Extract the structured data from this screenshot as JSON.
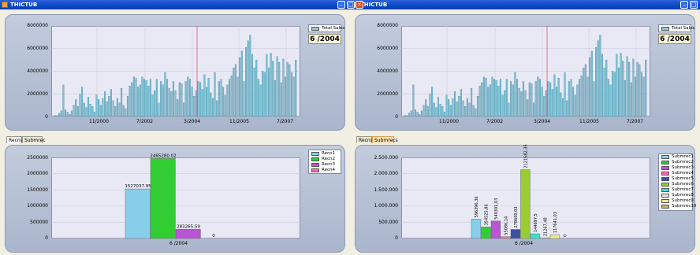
{
  "windows": [
    {
      "id": "left",
      "title": "THICTUB",
      "top_chart": {
        "chart_data": {
          "type": "bar",
          "series": [
            {
              "name": "Total Sales"
            }
          ],
          "x_tick_labels": [
            "11/2000",
            "7/2002",
            "3/2004",
            "11/2005",
            "7/2007"
          ],
          "y_tick_labels": [
            "8000000",
            "6000000",
            "4000000",
            "2000000",
            "0"
          ],
          "ylim": [
            0,
            8000000
          ],
          "cursor_label": "6 /2004",
          "values_millions": [
            0.1,
            0.1,
            0.3,
            0.5,
            2.8,
            0.6,
            0.4,
            0.2,
            0.5,
            1.0,
            1.5,
            0.9,
            2.0,
            2.6,
            1.2,
            0.8,
            1.7,
            1.1,
            0.9,
            0.4,
            1.9,
            1.5,
            1.0,
            1.6,
            2.2,
            1.3,
            1.8,
            2.4,
            1.4,
            0.9,
            1.6,
            1.2,
            2.5,
            1.0,
            0.7,
            1.8,
            2.7,
            3.0,
            3.5,
            3.4,
            2.6,
            2.8,
            3.5,
            3.3,
            3.2,
            2.7,
            3.3,
            1.9,
            2.3,
            3.3,
            1.2,
            3.1,
            2.8,
            3.9,
            3.3,
            2.5,
            2.2,
            3.1,
            2.3,
            1.5,
            3.0,
            2.9,
            1.2,
            3.1,
            3.5,
            3.3,
            2.6,
            1.8,
            2.3,
            3.1,
            3.0,
            2.4,
            3.7,
            2.6,
            3.4,
            2.1,
            1.6,
            3.9,
            1.4,
            3.1,
            3.3,
            2.6,
            1.9,
            2.8,
            3.3,
            3.6,
            4.3,
            4.6,
            3.5,
            5.2,
            5.8,
            3.1,
            6.1,
            6.7,
            7.2,
            5.5,
            4.3,
            5.0,
            3.3,
            2.8,
            4.0,
            3.9,
            5.5,
            4.3,
            5.6,
            4.9,
            3.2,
            5.3,
            4.8,
            3.0,
            5.1,
            3.5,
            4.8,
            4.6,
            3.9,
            3.5,
            5.0
          ]
        }
      },
      "tabs": [
        "Recns",
        "Submrec"
      ],
      "active_tab": 0,
      "bottom_chart": {
        "chart_data": {
          "type": "bar",
          "categories": [
            "6 /2004"
          ],
          "y_tick_labels": [
            "2500000",
            "2000000",
            "1500000",
            "1000000",
            "500000",
            "0"
          ],
          "ylim": [
            0,
            2500000
          ],
          "series": [
            {
              "name": "Recn1",
              "value": 1527037.95,
              "label": "1527037.95",
              "color": "#87ceeb"
            },
            {
              "name": "Recn2",
              "value": 2465280.02,
              "label": "2465280.02",
              "color": "#32cd32"
            },
            {
              "name": "Recn3",
              "value": 283265.59,
              "label": "283265.59",
              "color": "#ba55d3"
            },
            {
              "name": "Recn4",
              "value": 0,
              "label": "0",
              "color": "#ff69b4"
            }
          ]
        }
      }
    },
    {
      "id": "right",
      "title": "THICTUB",
      "top_chart": {
        "chart_data": {
          "type": "bar",
          "series": [
            {
              "name": "Total Sales"
            }
          ],
          "x_tick_labels": [
            "11/2000",
            "7/2002",
            "3/2004",
            "11/2005",
            "7/2007"
          ],
          "y_tick_labels": [
            "8000000",
            "6000000",
            "4000000",
            "2000000",
            "0"
          ],
          "ylim": [
            0,
            8000000
          ],
          "cursor_label": "6 /2004",
          "values_millions": [
            0.1,
            0.1,
            0.3,
            0.5,
            2.8,
            0.6,
            0.4,
            0.2,
            0.5,
            1.0,
            1.5,
            0.9,
            2.0,
            2.6,
            1.2,
            0.8,
            1.7,
            1.1,
            0.9,
            0.4,
            1.9,
            1.5,
            1.0,
            1.6,
            2.2,
            1.3,
            1.8,
            2.4,
            1.4,
            0.9,
            1.6,
            1.2,
            2.5,
            1.0,
            0.7,
            1.8,
            2.7,
            3.0,
            3.5,
            3.4,
            2.6,
            2.8,
            3.5,
            3.3,
            3.2,
            2.7,
            3.3,
            1.9,
            2.3,
            3.3,
            1.2,
            3.1,
            2.8,
            3.9,
            3.3,
            2.5,
            2.2,
            3.1,
            2.3,
            1.5,
            3.0,
            2.9,
            1.2,
            3.1,
            3.5,
            3.3,
            2.6,
            1.8,
            2.3,
            3.1,
            3.0,
            2.4,
            3.7,
            2.6,
            3.4,
            2.1,
            1.6,
            3.9,
            1.4,
            3.1,
            3.3,
            2.6,
            1.9,
            2.8,
            3.3,
            3.6,
            4.3,
            4.6,
            3.5,
            5.2,
            5.8,
            3.1,
            6.1,
            6.7,
            7.2,
            5.5,
            4.3,
            5.0,
            3.3,
            2.8,
            4.0,
            3.9,
            5.5,
            4.3,
            5.6,
            4.9,
            3.2,
            5.3,
            4.8,
            3.0,
            5.1,
            3.5,
            4.8,
            4.6,
            3.9,
            3.5,
            5.0
          ]
        }
      },
      "tabs": [
        "Recns",
        "Submrecs"
      ],
      "active_tab": 1,
      "bottom_chart": {
        "chart_data": {
          "type": "bar",
          "categories": [
            "6 /2004"
          ],
          "y_tick_labels": [
            "2.500.000",
            "2.000.000",
            "1.500.000",
            "1.000.000",
            "500.000",
            "0"
          ],
          "ylim": [
            0,
            2500000
          ],
          "series": [
            {
              "name": "Submrec1",
              "value": 596396.36,
              "label": "596396,36",
              "color": "#87ceeb"
            },
            {
              "name": "Submrec2",
              "value": 354525.86,
              "label": "354525,86",
              "color": "#32cd32"
            },
            {
              "name": "Submrec3",
              "value": 540301.03,
              "label": "540301,03",
              "color": "#ba55d3"
            },
            {
              "name": "Submrec4",
              "value": 55086.14,
              "label": "55086,14",
              "color": "#ff69b4"
            },
            {
              "name": "Submrec5",
              "value": 278600.03,
              "label": "278600,03",
              "color": "#3d4fa0"
            },
            {
              "name": "Submrec6",
              "value": 2121582.35,
              "label": "2121582,35",
              "color": "#9acd32"
            },
            {
              "name": "Submrec7",
              "value": 144697.5,
              "label": "144697,5",
              "color": "#40e0d0"
            },
            {
              "name": "Submrec8",
              "value": 21267.48,
              "label": "21267,48",
              "color": "#e4e4e4"
            },
            {
              "name": "Submrec9",
              "value": 117641.03,
              "label": "117641,03",
              "color": "#f0e68c"
            },
            {
              "name": "Submrec10",
              "value": 0,
              "label": "0",
              "color": "#c4b07a"
            }
          ]
        }
      }
    }
  ]
}
